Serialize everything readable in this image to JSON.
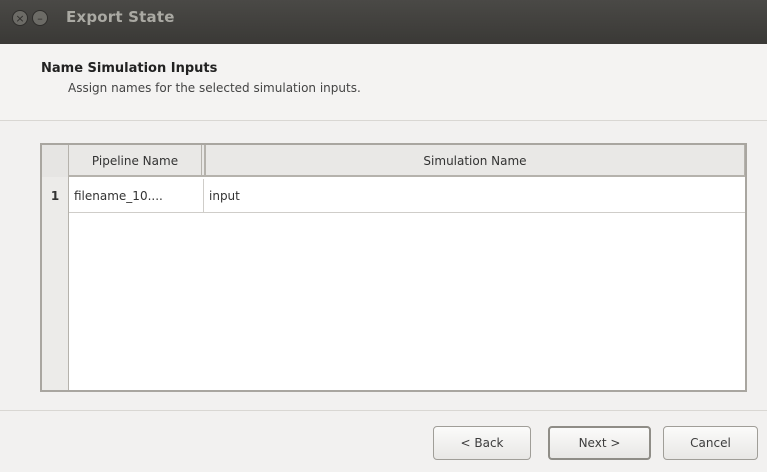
{
  "window": {
    "title": "Export State",
    "close_glyph": "×",
    "min_glyph": "–"
  },
  "header": {
    "title": "Name Simulation Inputs",
    "subtitle": "Assign names for the selected simulation inputs."
  },
  "table": {
    "columns": [
      "Pipeline Name",
      "Simulation Name"
    ],
    "rows": [
      {
        "index": "1",
        "pipeline_name": "filename_10....",
        "simulation_name": "input"
      }
    ]
  },
  "buttons": {
    "back": "< Back",
    "next": "Next >",
    "cancel": "Cancel"
  },
  "icons": [
    "close-icon",
    "minimize-icon"
  ]
}
